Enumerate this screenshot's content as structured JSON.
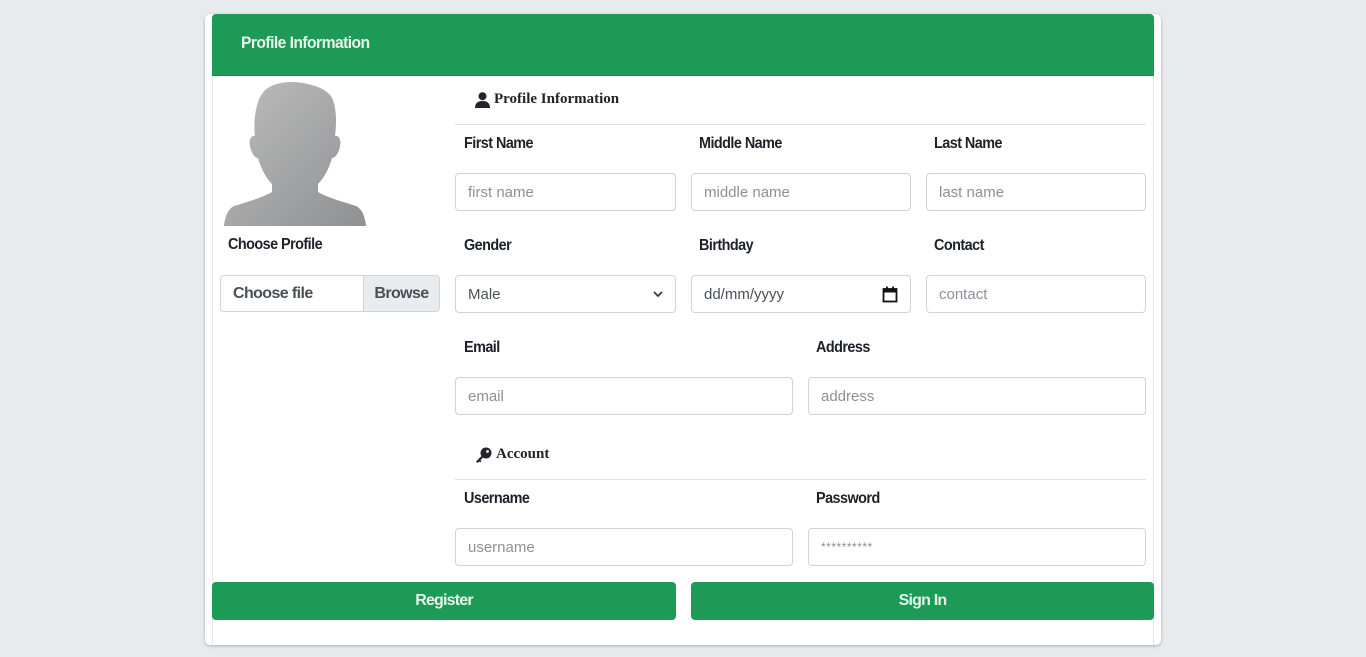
{
  "header": {
    "title": "Profile Information"
  },
  "profile": {
    "avatar_alt": "default-avatar",
    "choose_label": "Choose Profile",
    "file_placeholder": "Choose file",
    "browse_label": "Browse"
  },
  "sections": {
    "profile": {
      "title": "Profile Information",
      "icon": "user-icon"
    },
    "account": {
      "title": "Account",
      "icon": "key-icon"
    }
  },
  "fields": {
    "first_name": {
      "label": "First Name",
      "placeholder": "first name"
    },
    "middle_name": {
      "label": "Middle Name",
      "placeholder": "middle name"
    },
    "last_name": {
      "label": "Last Name",
      "placeholder": "last name"
    },
    "gender": {
      "label": "Gender",
      "value": "Male"
    },
    "birthday": {
      "label": "Birthday",
      "placeholder": "dd/mm/yyyy"
    },
    "contact": {
      "label": "Contact",
      "placeholder": "contact"
    },
    "email": {
      "label": "Email",
      "placeholder": "email"
    },
    "address": {
      "label": "Address",
      "placeholder": "address"
    },
    "username": {
      "label": "Username",
      "placeholder": "username"
    },
    "password": {
      "label": "Password",
      "placeholder": "**********"
    }
  },
  "buttons": {
    "register": "Register",
    "sign_in": "Sign In"
  },
  "colors": {
    "accent": "#1e9a57",
    "background": "#e8ebee"
  }
}
